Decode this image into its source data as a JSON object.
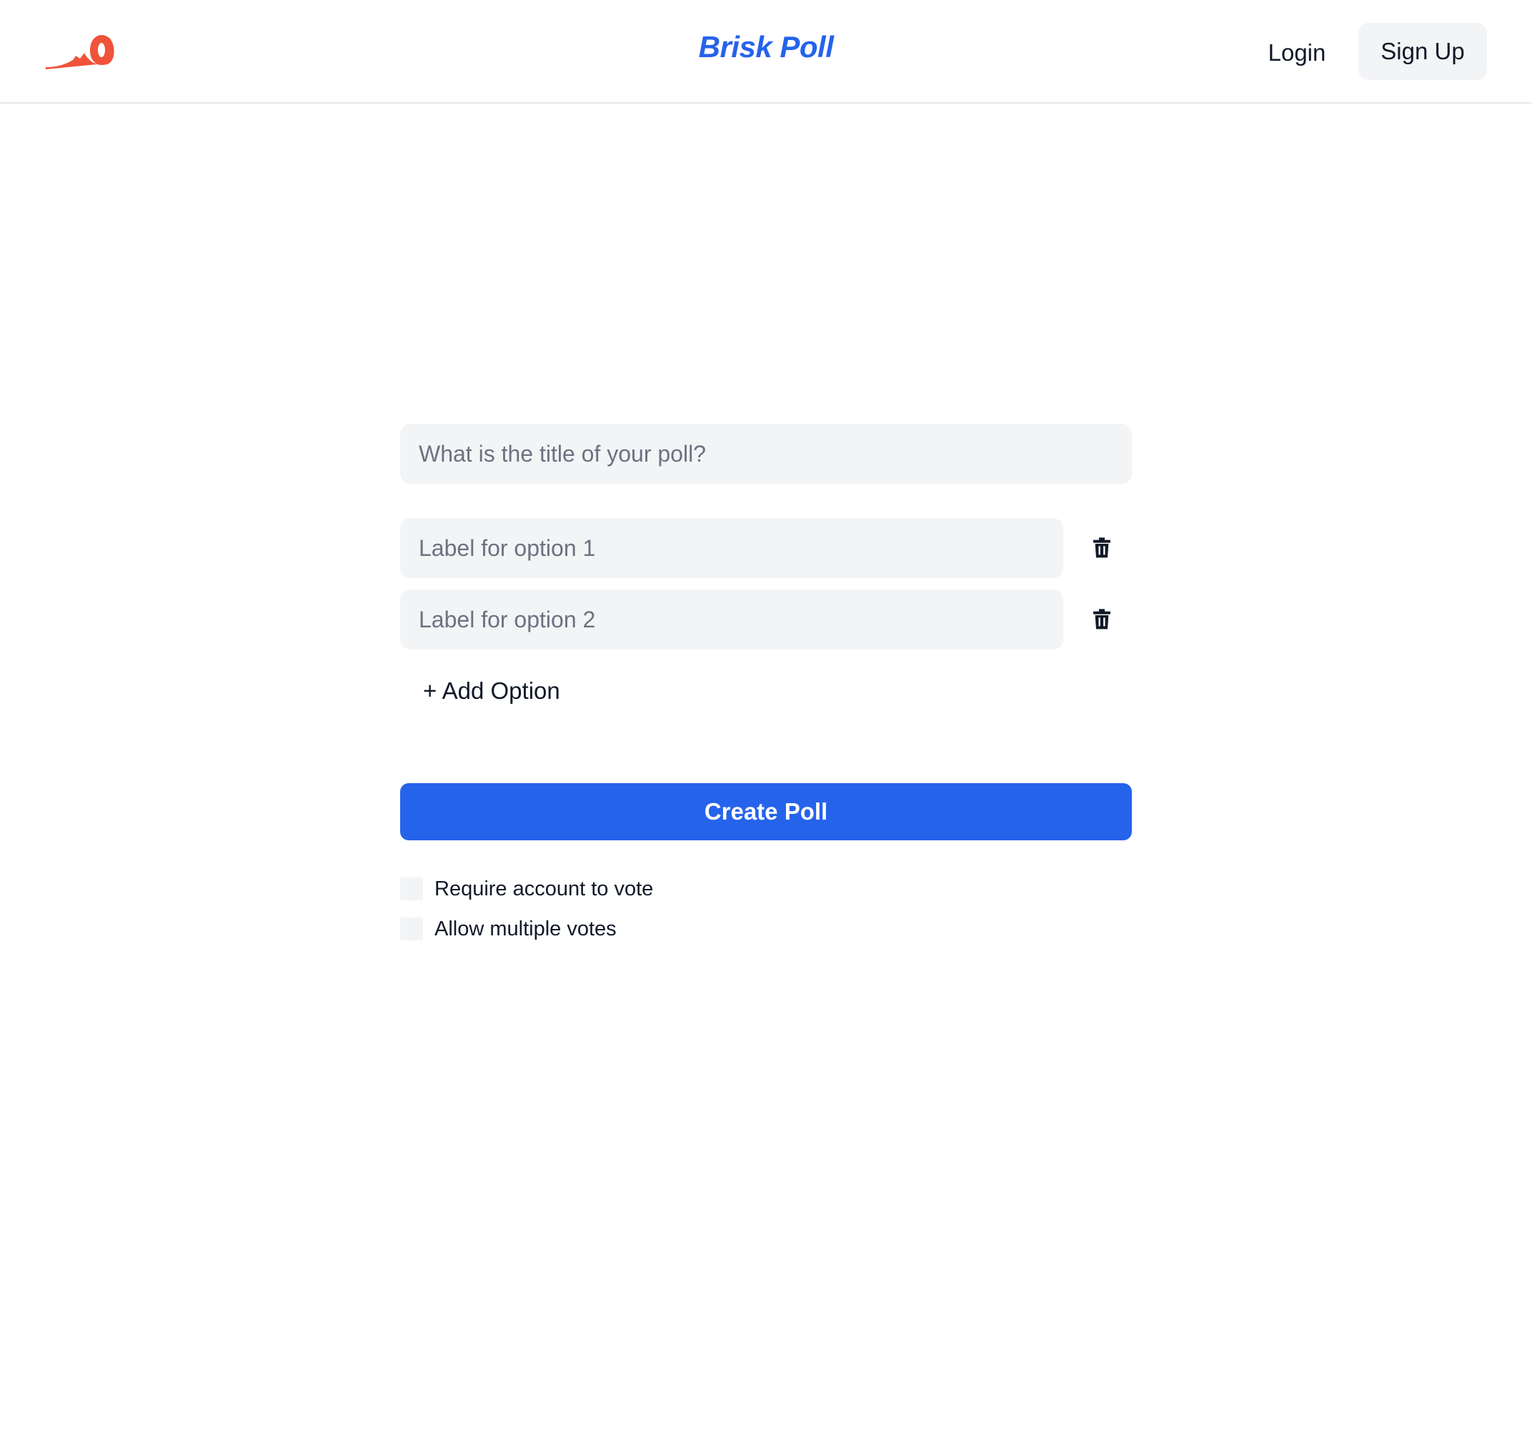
{
  "header": {
    "brand": "Brisk Poll",
    "logo_icon": "running-fox-icon",
    "login_label": "Login",
    "signup_label": "Sign Up"
  },
  "form": {
    "title_placeholder": "What is the title of your poll?",
    "title_value": "",
    "options": [
      {
        "placeholder": "Label for option 1",
        "value": "",
        "delete_icon": "trash-icon"
      },
      {
        "placeholder": "Label for option 2",
        "value": "",
        "delete_icon": "trash-icon"
      }
    ],
    "add_option_label": "+ Add Option",
    "create_label": "Create Poll",
    "settings": [
      {
        "label": "Require account to vote",
        "checked": false
      },
      {
        "label": "Allow multiple votes",
        "checked": false
      }
    ]
  },
  "colors": {
    "accent": "#2563eb",
    "logo": "#f0533a",
    "field_bg": "#f3f4f6",
    "text": "#111827",
    "placeholder": "#6b7280"
  }
}
